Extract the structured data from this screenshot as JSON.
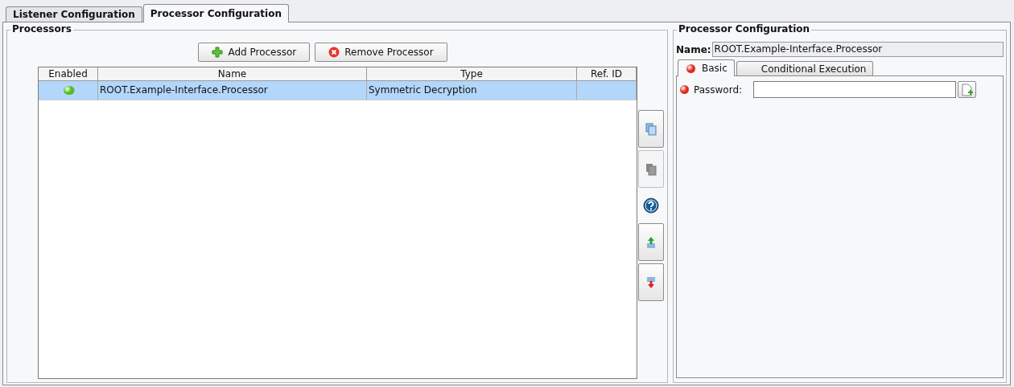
{
  "tabs": [
    {
      "label": "Listener Configuration",
      "selected": false
    },
    {
      "label": "Processor Configuration",
      "selected": true
    }
  ],
  "processors": {
    "title": "Processors",
    "buttons": [
      {
        "kind": "add",
        "label": "Add Processor"
      },
      {
        "kind": "remove",
        "label": "Remove Processor"
      }
    ],
    "table": {
      "columns": [
        "Enabled",
        "Name",
        "Type",
        "Ref. ID"
      ],
      "rows": [
        {
          "enabled": true,
          "name": "ROOT.Example-Interface.Processor",
          "type": "Symmetric Decryption",
          "selected": true
        }
      ]
    },
    "side_buttons": [
      {
        "kind": "copy",
        "disabled": false
      },
      {
        "kind": "paste",
        "disabled": true
      },
      {
        "kind": "help",
        "disabled": false
      },
      {
        "kind": "move-up",
        "disabled": false
      },
      {
        "kind": "move-down",
        "disabled": false
      }
    ]
  },
  "configuration": {
    "title": "Processor Configuration",
    "name_label": "Name:",
    "name_value": "ROOT.Example-Interface.Processor",
    "tabs": [
      {
        "label": "Basic",
        "selected": true,
        "error": true
      },
      {
        "label": "Conditional Execution",
        "selected": false,
        "error": false
      }
    ],
    "fields": [
      {
        "label": "Password:",
        "error": true
      }
    ]
  }
}
